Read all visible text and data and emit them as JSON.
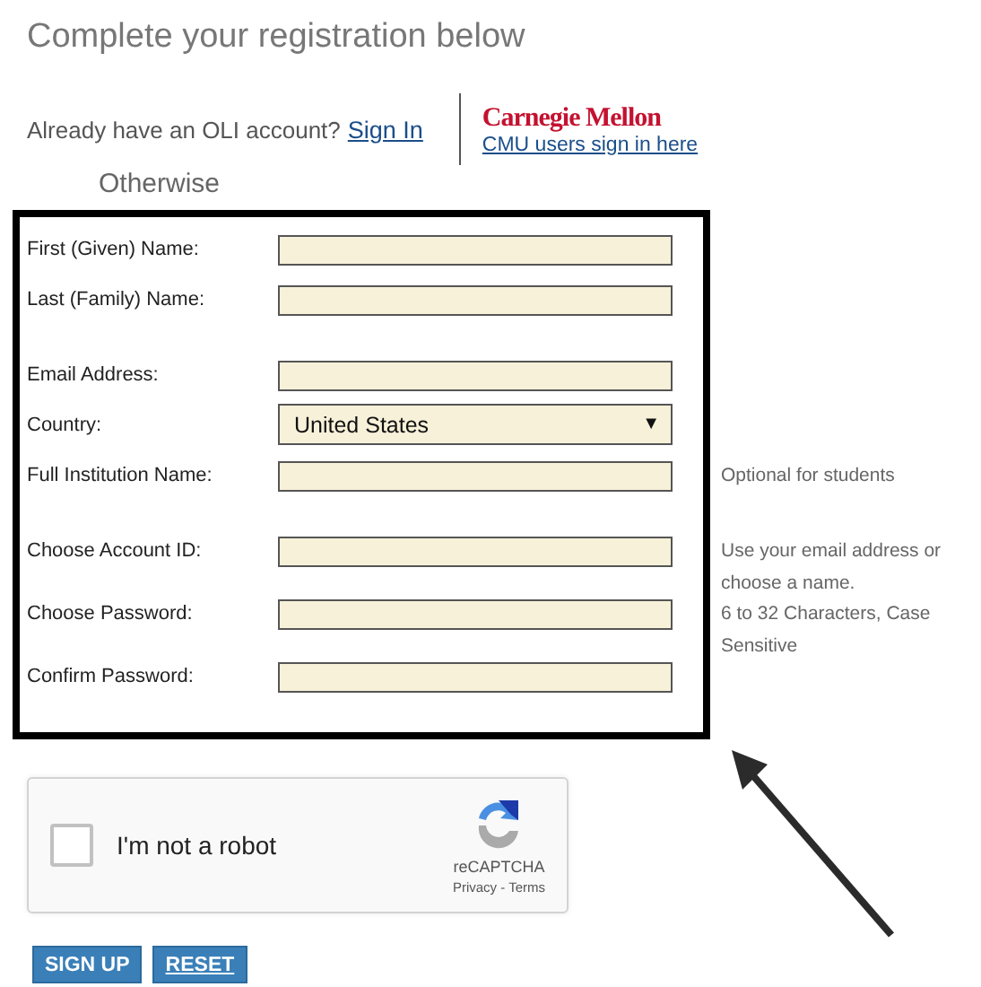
{
  "title": "Complete your registration below",
  "signin": {
    "prompt": "Already have an OLI account?",
    "link": "Sign In"
  },
  "cmu": {
    "logo": "Carnegie Mellon",
    "link": "CMU users sign in here"
  },
  "otherwise": "Otherwise",
  "field_groups": [
    [
      {
        "kind": "text",
        "label": "First (Given) Name:"
      },
      {
        "kind": "text",
        "label": "Last (Family) Name:"
      }
    ],
    [
      {
        "kind": "text",
        "label": "Email Address:"
      },
      {
        "kind": "select",
        "label": "Country:",
        "value": "United States",
        "caret": "▼"
      },
      {
        "kind": "text",
        "label": "Full Institution Name:",
        "hint": "Optional for students"
      }
    ],
    [
      {
        "kind": "text",
        "label": "Choose Account ID:",
        "hint": "Use your email address or choose a name."
      },
      {
        "kind": "password",
        "label": "Choose Password:",
        "hint": "6 to 32 Characters, Case Sensitive"
      },
      {
        "kind": "password",
        "label": "Confirm Password:"
      }
    ]
  ],
  "captcha": {
    "checked": false,
    "label": "I'm not a robot",
    "brand": "reCAPTCHA",
    "links": "Privacy - Terms"
  },
  "buttons": [
    "SIGN UP",
    "RESET"
  ]
}
